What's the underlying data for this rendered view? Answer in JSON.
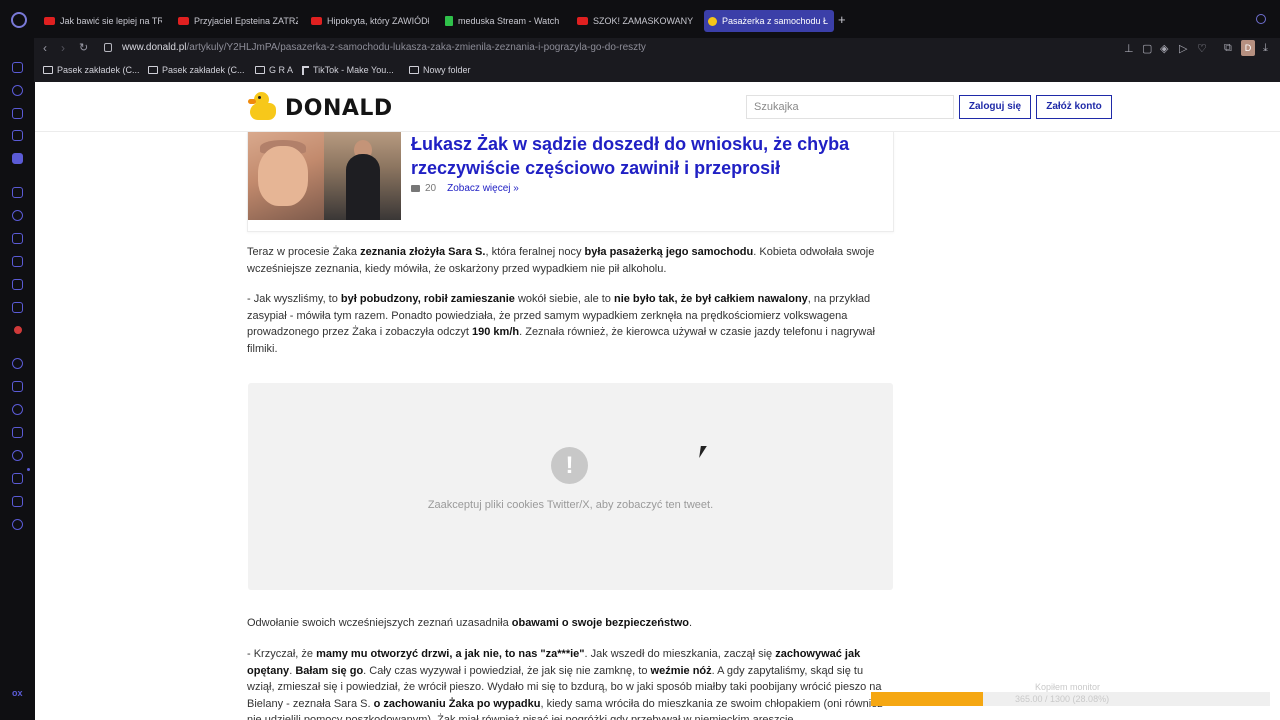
{
  "browser": {
    "tabs": [
      {
        "label": "Jak bawić sie lepiej na TR",
        "icon": "youtube-icon"
      },
      {
        "label": "Przyjaciel Epsteina ZATRZ",
        "icon": "youtube-icon"
      },
      {
        "label": "Hipokryta, który ZAWIÓDŁ",
        "icon": "youtube-icon"
      },
      {
        "label": "meduska Stream - Watch",
        "icon": "kick-icon"
      },
      {
        "label": "SZOK! ZAMASKOWANY C",
        "icon": "youtube-icon"
      },
      {
        "label": "Pasażerka z samochodu Ł",
        "icon": "donald-duck-icon",
        "active": true
      }
    ],
    "new_tab": "+",
    "url": {
      "host": "www.donald.pl",
      "path": "/artykuly/Y2HLJmPA/pasazerka-z-samochodu-lukasza-zaka-zmienila-zeznania-i-pograzyla-go-do-reszty"
    },
    "profile_initial": "D",
    "bookmarks": [
      {
        "label": "Pasek zakładek (C...",
        "icon": "folder-icon"
      },
      {
        "label": "Pasek zakładek (C...",
        "icon": "folder-icon"
      },
      {
        "label": "G R A",
        "icon": "folder-icon"
      },
      {
        "label": "TikTok - Make You...",
        "icon": "tiktok-icon"
      },
      {
        "label": "Nowy folder",
        "icon": "folder-icon"
      }
    ],
    "sidebar_more": "ox"
  },
  "site": {
    "logo_text": "DONALD",
    "search_placeholder": "Szukajka",
    "login_label": "Zaloguj się",
    "register_label": "Załóż konto",
    "accent_color": "#2020c4"
  },
  "related": {
    "title": "Łukasz Żak w sądzie doszedł do wniosku, że chyba rzeczywiście częściowo zawinił i przeprosił",
    "comments": "20",
    "see_more": "Zobacz więcej »"
  },
  "article": {
    "p1": {
      "t1": "Teraz w procesie Żaka ",
      "b1": "zeznania złożyła Sara S.",
      "t2": ", która feralnej nocy ",
      "b2": "była pasażerką jego samochodu",
      "t3": ". Kobieta odwołała swoje wcześniejsze zeznania, kiedy mówiła, że oskarżony przed wypadkiem nie pił alkoholu."
    },
    "p2": {
      "t1": "- Jak wyszliśmy, to ",
      "b1": "był pobudzony, robił zamieszanie",
      "t2": " wokół siebie, ale to ",
      "b2": "nie było tak, że był całkiem nawalony",
      "t3": ", na przykład zasypiał - mówiła tym razem. Ponadto powiedziała, że przed samym wypadkiem zerknęła na prędkościomierz volkswagena prowadzonego przez Żaka i zobaczyła odczyt ",
      "b3": "190 km/h",
      "t4": ". Zeznała również, że kierowca używał w czasie jazdy telefonu i nagrywał filmiki."
    },
    "tweet_notice": "Zaakceptuj pliki cookies Twitter/X, aby zobaczyć ten tweet.",
    "tweet_icon": "!",
    "p3": {
      "t1": "Odwołanie swoich wcześniejszych zeznań uzasadniła ",
      "b1": "obawami o swoje bezpieczeństwo",
      "t2": "."
    },
    "p4": {
      "t1": "- Krzyczał, że ",
      "b1": "mamy mu otworzyć drzwi, a jak nie, to nas \"za***ie\"",
      "t2": ". Jak wszedł do mieszkania, zaczął się ",
      "b2": "zachowywać jak opętany",
      "t3": ". ",
      "b3": "Bałam się go",
      "t4": ". Cały czas wyzywał i powiedział, że jak się nie zamknę, to ",
      "b4": "weźmie nóż",
      "t5": ". A gdy zapytaliśmy, skąd się tu wziął, zmieszał się i powiedział, że wrócił pieszo. Wydało mi się to bzdurą, bo w jaki sposób miałby taki poobijany wrócić pieszo na Bielany - zeznała Sara S. ",
      "b5": "o zachowaniu Żaka po wypadku",
      "t6": ", kiedy sama wróciła do mieszkania ze swoim chłopakiem (oni również nie udzielili pomocy poszkodowanym). Żak miał również pisać jej pogróżki gdy przebywał w niemieckim areszcie."
    }
  },
  "overlay": {
    "label": "Kopiłem monitor",
    "progress_text": "365.00 / 1300 (28.08%)",
    "progress_fraction": 0.2808,
    "color": "#f5a712"
  }
}
